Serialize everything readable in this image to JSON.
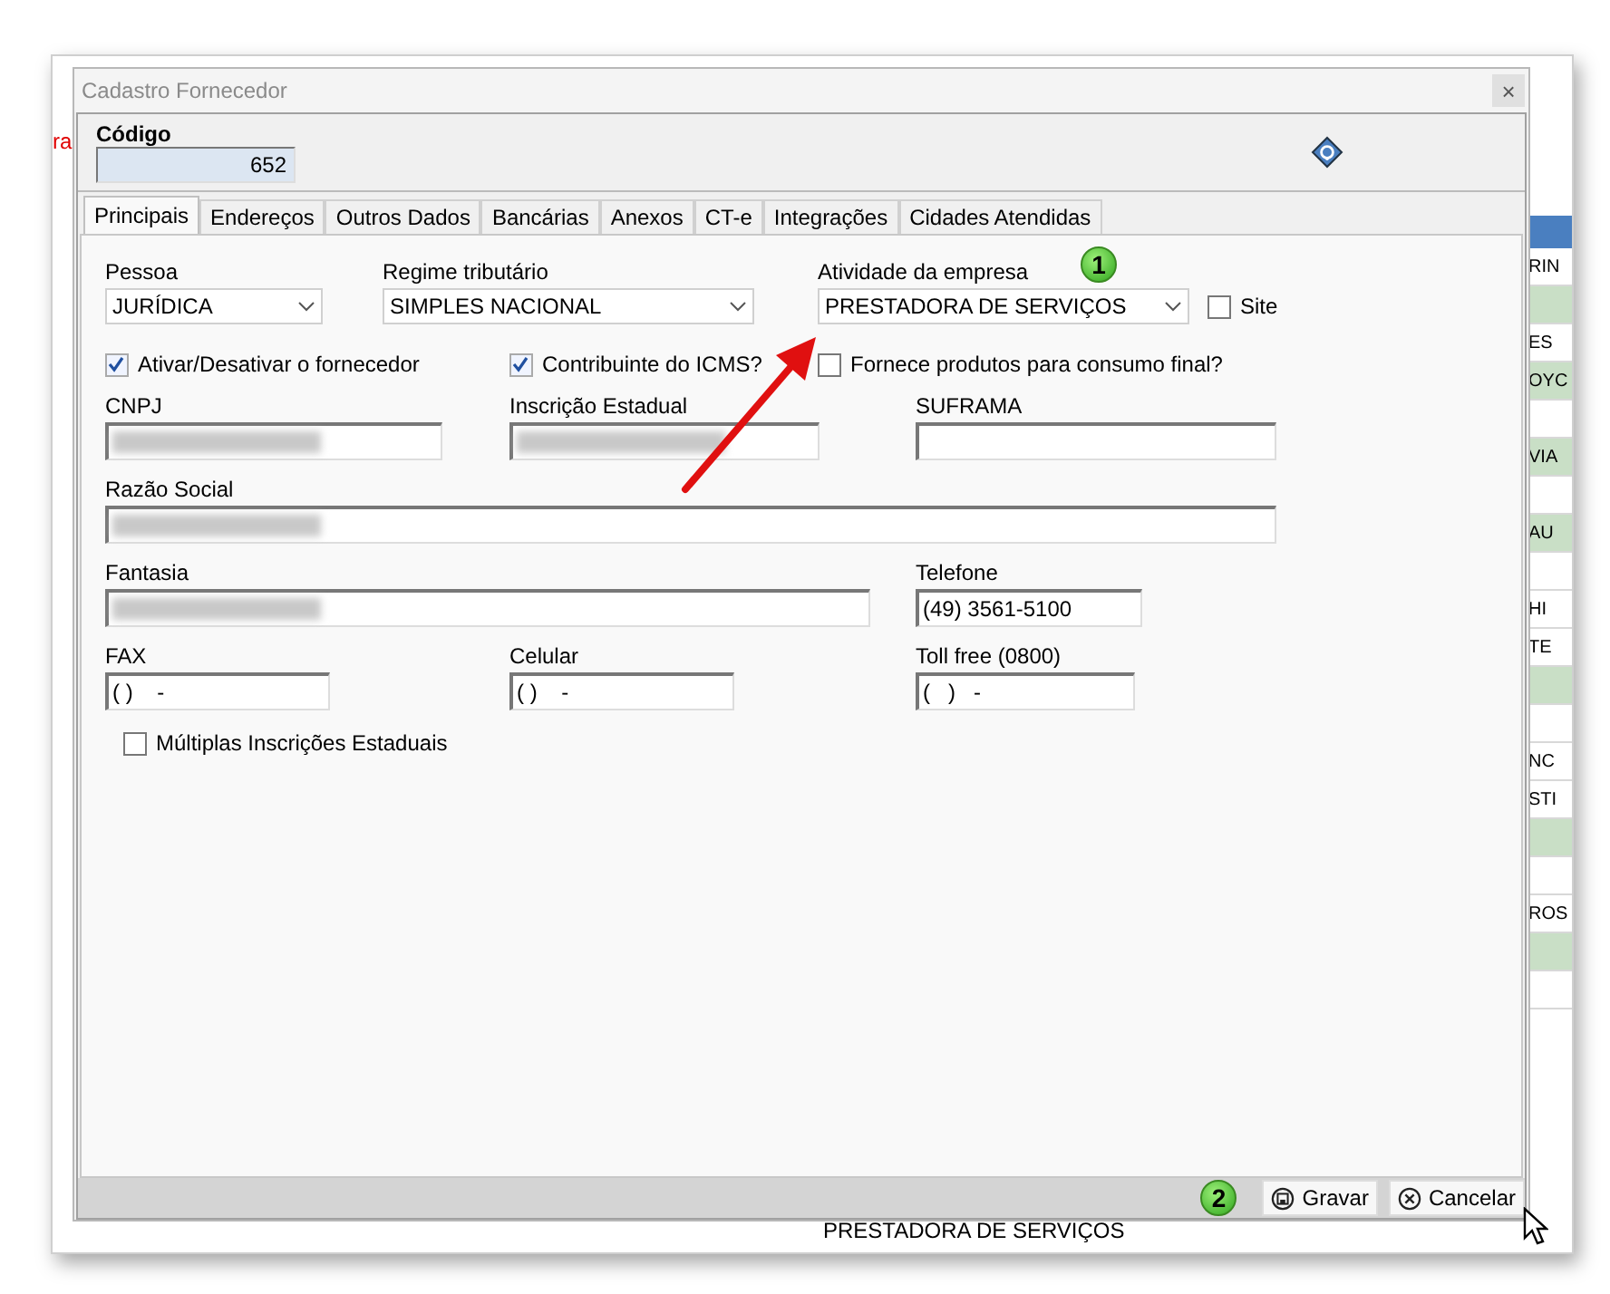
{
  "background_app": {
    "left_text": "ra",
    "bottom_text": "PRESTADORA DE SERVIÇOS",
    "right_rows": [
      {
        "text": "RIN",
        "green": false
      },
      {
        "text": "",
        "green": true
      },
      {
        "text": "ES",
        "green": false
      },
      {
        "text": "OYC",
        "green": true
      },
      {
        "text": "",
        "green": false
      },
      {
        "text": "VIA",
        "green": true
      },
      {
        "text": "",
        "green": false
      },
      {
        "text": "AU",
        "green": true
      },
      {
        "text": "",
        "green": false
      },
      {
        "text": "HI",
        "green": false
      },
      {
        "text": "TE",
        "green": false
      },
      {
        "text": "",
        "green": true
      },
      {
        "text": "",
        "green": false
      },
      {
        "text": "NC",
        "green": false
      },
      {
        "text": "STI",
        "green": false
      },
      {
        "text": "",
        "green": true
      },
      {
        "text": "",
        "green": false
      },
      {
        "text": "ROS",
        "green": false
      },
      {
        "text": "",
        "green": true
      },
      {
        "text": "",
        "green": false
      }
    ]
  },
  "window": {
    "title": "Cadastro Fornecedor",
    "close": "×"
  },
  "header": {
    "code_label": "Código",
    "code_value": "652"
  },
  "tabs": [
    {
      "label": "Principais",
      "selected": true
    },
    {
      "label": "Endereços",
      "selected": false
    },
    {
      "label": "Outros Dados",
      "selected": false
    },
    {
      "label": "Bancárias",
      "selected": false
    },
    {
      "label": "Anexos",
      "selected": false
    },
    {
      "label": "CT-e",
      "selected": false
    },
    {
      "label": "Integrações",
      "selected": false
    },
    {
      "label": "Cidades Atendidas",
      "selected": false
    }
  ],
  "form_rows": [
    [
      {
        "kind": "select",
        "label": "Pessoa",
        "value": "JURÍDICA"
      },
      {
        "kind": "select",
        "label": "Regime tributário",
        "value": "SIMPLES NACIONAL"
      },
      {
        "kind": "select",
        "label": "Atividade da empresa",
        "value": "PRESTADORA DE SERVIÇOS"
      },
      {
        "kind": "checkbox",
        "label": "Site",
        "checked": false
      }
    ],
    [
      {
        "kind": "checkbox",
        "label": "Ativar/Desativar o fornecedor",
        "checked": true
      },
      {
        "kind": "checkbox",
        "label": "Contribuinte do ICMS?",
        "checked": true
      },
      {
        "kind": "checkbox",
        "label": "Fornece produtos para consumo final?",
        "checked": false
      }
    ],
    [
      {
        "kind": "text",
        "label": "CNPJ",
        "blurred": true
      },
      {
        "kind": "text",
        "label": "Inscrição Estadual",
        "blurred": true
      },
      {
        "kind": "text",
        "label": "SUFRAMA"
      }
    ],
    [
      {
        "kind": "text",
        "label": "Razão Social",
        "blurred": true
      }
    ],
    [
      {
        "kind": "text",
        "label": "Fantasia",
        "blurred": true
      },
      {
        "kind": "text",
        "label": "Telefone",
        "value": "(49) 3561-5100"
      }
    ],
    [
      {
        "kind": "text",
        "label": "FAX",
        "value": "( )    -"
      },
      {
        "kind": "text",
        "label": "Celular",
        "value": "( )    -"
      },
      {
        "kind": "text",
        "label": "Toll free (0800)",
        "value": "(   )   -"
      }
    ],
    [
      {
        "kind": "checkbox",
        "label": "Múltiplas Inscrições Estaduais",
        "checked": false
      }
    ]
  ],
  "buttons": [
    {
      "kind": "save",
      "label": "Gravar"
    },
    {
      "kind": "cancel",
      "label": "Cancelar"
    }
  ],
  "annotations": [
    {
      "kind": "badge",
      "text": "1"
    },
    {
      "kind": "badge",
      "text": "2"
    }
  ]
}
